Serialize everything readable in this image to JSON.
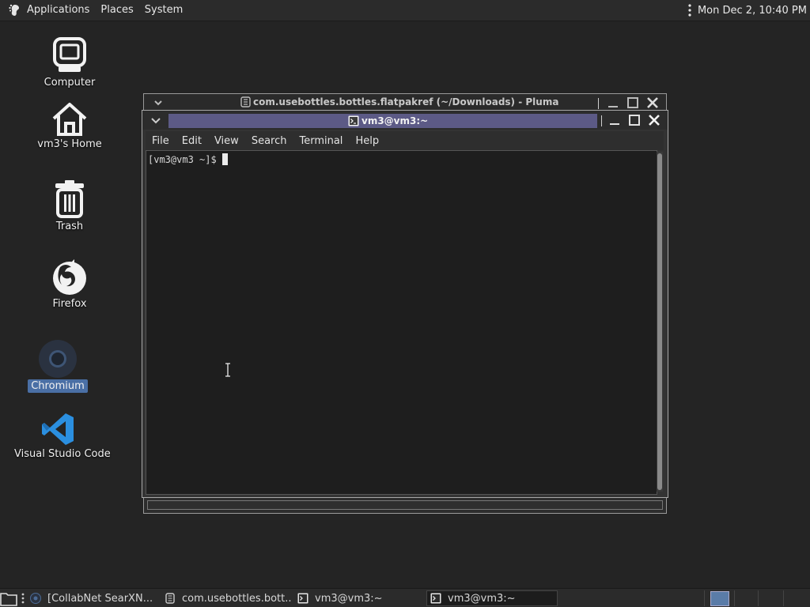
{
  "top_panel": {
    "menus": [
      "Applications",
      "Places",
      "System"
    ],
    "clock": "Mon Dec 2, 10:40 PM",
    "icons": {
      "apps": "gnome-foot-icon",
      "overflow": "kebab-icon"
    }
  },
  "desktop": {
    "icons": [
      {
        "label": "Computer",
        "icon": "computer-icon"
      },
      {
        "label": "vm3's Home",
        "icon": "home-icon"
      },
      {
        "label": "Trash",
        "icon": "trash-icon"
      },
      {
        "label": "Firefox",
        "icon": "firefox-icon"
      },
      {
        "label": "Chromium",
        "icon": "chromium-icon",
        "selected": true
      },
      {
        "label": "Visual Studio Code",
        "icon": "vscode-icon"
      }
    ]
  },
  "pluma_window": {
    "title": "com.usebottles.bottles.flatpakref (~/Downloads) - Pluma"
  },
  "terminal_window": {
    "title": "vm3@vm3:~",
    "menus": [
      "File",
      "Edit",
      "View",
      "Search",
      "Terminal",
      "Help"
    ],
    "prompt": "[vm3@vm3 ~]$"
  },
  "taskbar": {
    "items": [
      {
        "label": "[CollabNet SearXN...",
        "icon": "chromium-icon",
        "active": false
      },
      {
        "label": "com.usebottles.bott...",
        "icon": "text-editor-icon",
        "active": false
      },
      {
        "label": "vm3@vm3:~",
        "icon": "terminal-icon",
        "active": false
      },
      {
        "label": "vm3@vm3:~",
        "icon": "terminal-icon",
        "active": true
      }
    ]
  },
  "colors": {
    "desktop_bg": "#242424",
    "title_highlight": "#5c5a86",
    "selection": "#4a6fa5",
    "vscode_blue": "#2b8fe0"
  }
}
